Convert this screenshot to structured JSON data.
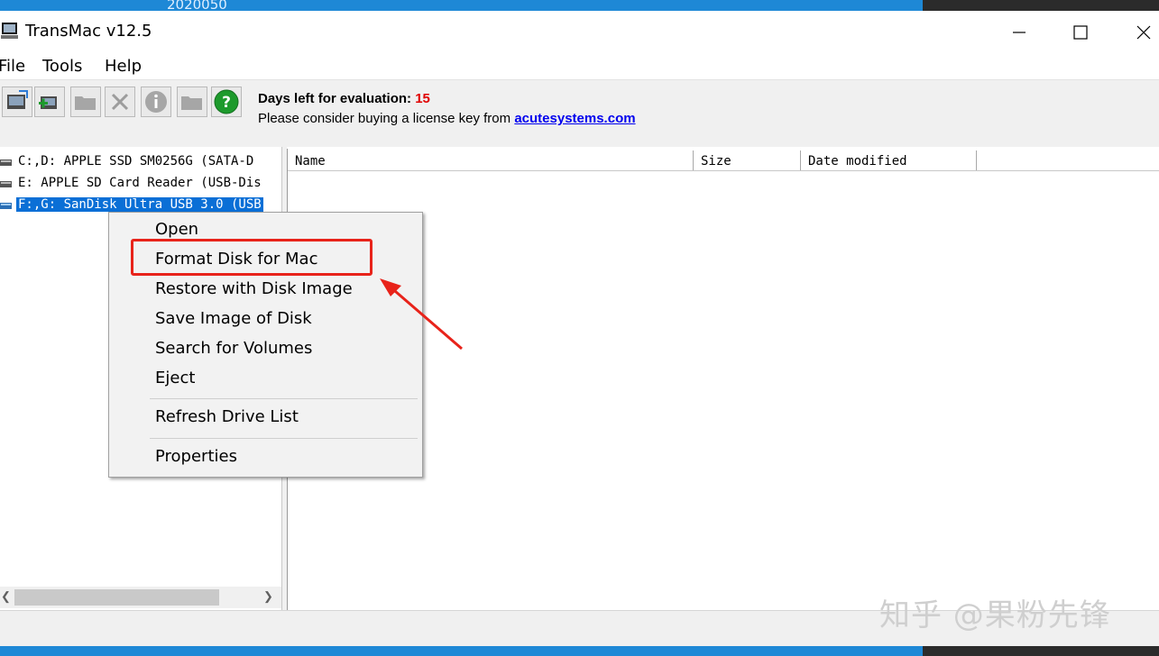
{
  "desktop": {
    "top_text": "2020050"
  },
  "window": {
    "title": "TransMac v12.5",
    "controls": [
      "minimize",
      "maximize",
      "close"
    ]
  },
  "menu": {
    "items": [
      "File",
      "Tools",
      "Help"
    ]
  },
  "toolbar": {
    "buttons": [
      "open-drive-icon",
      "add-icon",
      "folder-icon",
      "delete-icon",
      "info-icon",
      "new-folder-icon",
      "help-icon"
    ],
    "eval_label": "Days left for evaluation:",
    "eval_days": "15",
    "license_text": "Please consider buying a license key from",
    "license_link": "acutesystems.com"
  },
  "drives": [
    {
      "label": "C:,D:  APPLE SSD SM0256G (SATA-D"
    },
    {
      "label": "E: APPLE SD Card Reader (USB-Dis"
    },
    {
      "label": "F:,G: SanDisk Ultra USB 3.0 (USB",
      "selected": true
    }
  ],
  "file_list": {
    "columns": [
      "Name",
      "Size",
      "Date modified"
    ]
  },
  "context_menu": {
    "items": [
      "Open",
      "Format Disk for Mac",
      "Restore with Disk Image",
      "Save Image of Disk",
      "Search for Volumes",
      "Eject",
      "Refresh Drive List",
      "Properties"
    ],
    "highlighted": "Format Disk for Mac"
  },
  "watermark": "知乎 @果粉先锋",
  "colors": {
    "accent": "#0a6fd6",
    "annotation": "#e8231a",
    "eval_days": "#e00000",
    "link": "#0000ee"
  }
}
